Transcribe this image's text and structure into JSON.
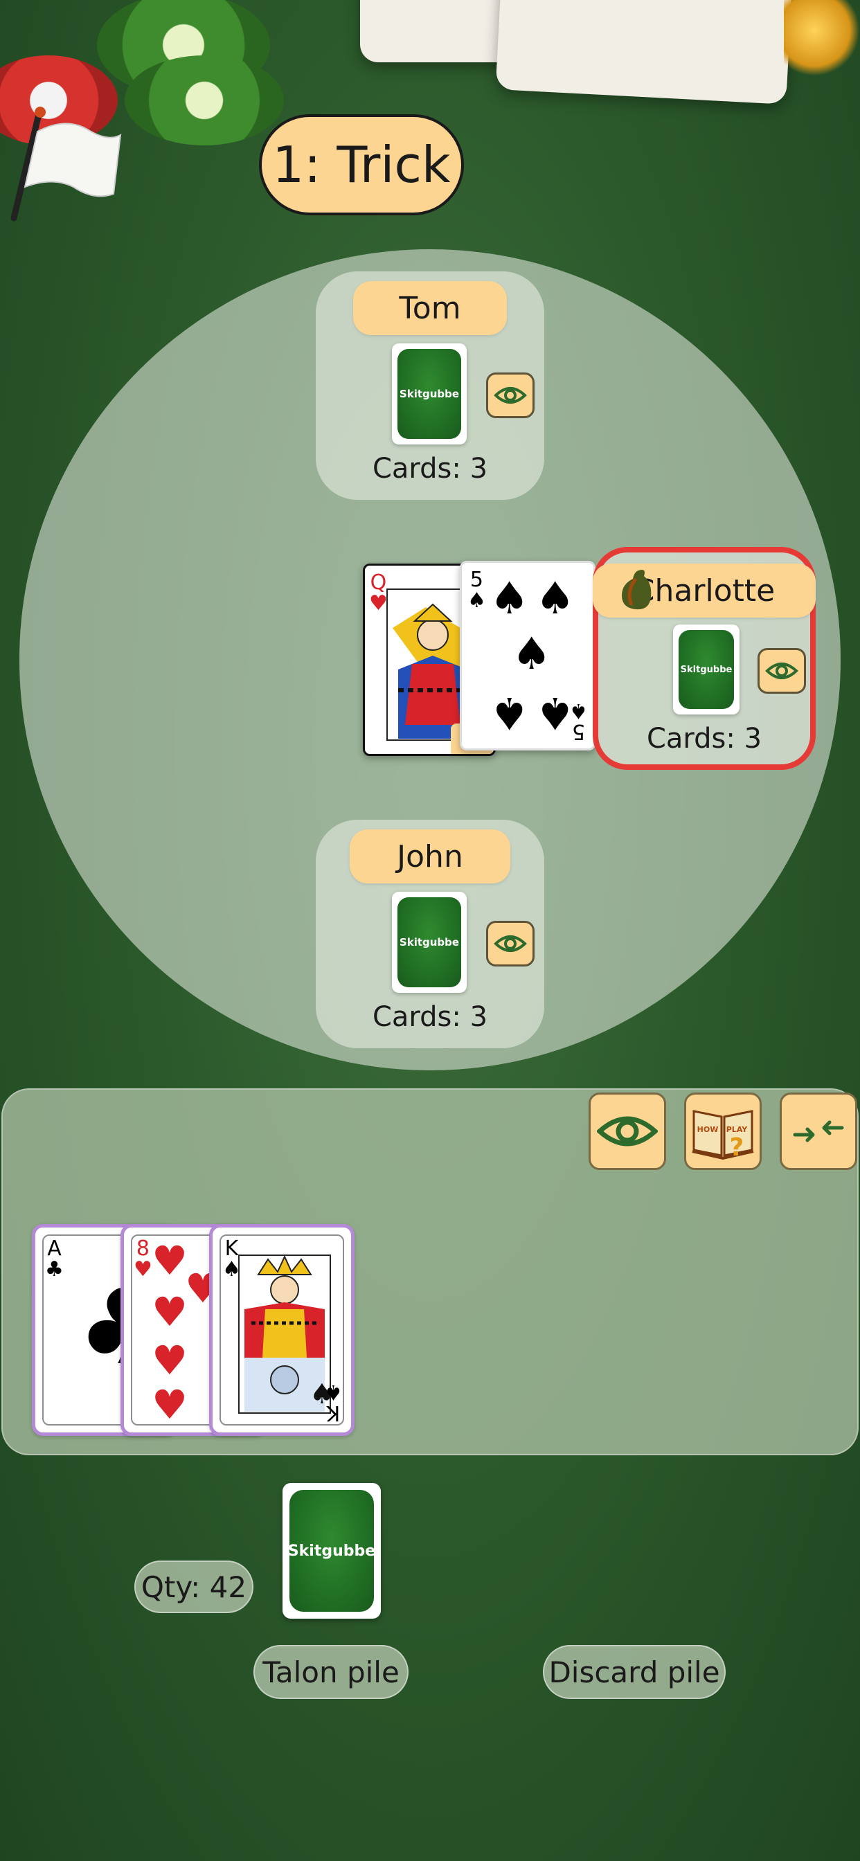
{
  "trick": {
    "label": "1: Trick"
  },
  "players": {
    "tom": {
      "name": "Tom",
      "card_back_text": "Skitgubbe",
      "cards_label": "Cards: 3"
    },
    "charlotte": {
      "name": "Charlotte",
      "card_back_text": "Skitgubbe",
      "cards_label": "Cards: 3"
    },
    "john": {
      "name": "John",
      "card_back_text": "Skitgubbe",
      "cards_label": "Cards: 3"
    }
  },
  "table_cards": [
    {
      "rank": "Q",
      "suit": "♥",
      "color": "#d8232a"
    },
    {
      "rank": "5",
      "suit": "♠",
      "color": "#111111"
    }
  ],
  "hand": [
    {
      "rank": "A",
      "suit": "♣",
      "color": "#111111"
    },
    {
      "rank": "8",
      "suit": "♥",
      "color": "#d8232a"
    },
    {
      "rank": "K",
      "suit": "♠",
      "color": "#111111"
    }
  ],
  "toolbar": {
    "eye_icon": "eye-icon",
    "how_to_play_icon": "how-to-play-book-icon",
    "how_to_play_text": "HOW TO PLAY",
    "collapse_icon": "collapse-arrows-icon"
  },
  "piles": {
    "qty_label": "Qty: 42",
    "talon_card_text": "Skitgubbe",
    "talon_label": "Talon pile",
    "discard_label": "Discard pile"
  },
  "colors": {
    "accent": "#fdd592",
    "active_border": "#e53a36",
    "hand_border": "#b48ad6",
    "table_bg": "#2c5a2c"
  }
}
